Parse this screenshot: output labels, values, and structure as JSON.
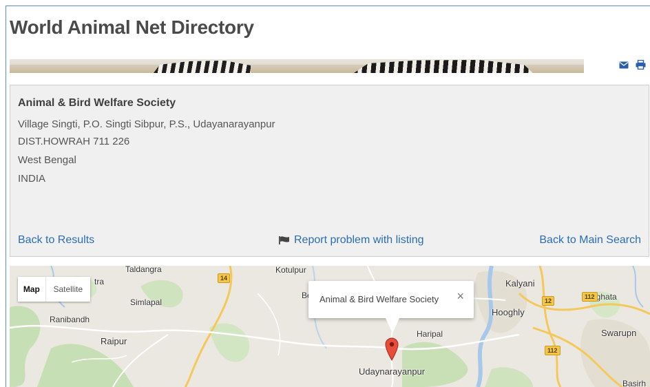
{
  "page": {
    "title": "World Animal Net Directory"
  },
  "icons": {
    "email": "envelope-icon",
    "print": "printer-icon",
    "report": "flag-icon",
    "marker": "map-marker-icon",
    "close": "close-icon"
  },
  "colors": {
    "link": "#2a6db3",
    "card_bg": "#f0f0f0",
    "title": "#4a4a4a"
  },
  "listing": {
    "name": "Animal & Bird Welfare Society",
    "address": [
      "Village Singti, P.O. Singti Sibpur, P.S., Udayanarayanpur",
      "DIST.HOWRAH 711 226",
      "West Bengal",
      "INDIA"
    ]
  },
  "links": {
    "back_to_results": "Back to Results",
    "report_problem": "Report problem with listing",
    "back_to_main": "Back to Main Search"
  },
  "map": {
    "type_buttons": {
      "map": "Map",
      "satellite": "Satellite"
    },
    "info_window": "Animal & Bird Welfare Society",
    "close_symbol": "×",
    "places": {
      "taldangra": "Taldangra",
      "kotulpur": "Kotulpur",
      "kalyani": "Kalyani",
      "simlapal": "Simlapal",
      "tra": "tra",
      "gaighata": "Gaighata",
      "ranibandh": "Ranibandh",
      "hooghly": "Hooghly",
      "raipur": "Raipur",
      "haripal": "Haripal",
      "swarupn": "Swarupn",
      "udaynarayanpur": "Udaynarayanpur",
      "basirh": "Basirh",
      "be": "Be"
    },
    "highways": {
      "h14": "14",
      "h12": "12",
      "h112a": "112",
      "h112b": "112"
    }
  }
}
